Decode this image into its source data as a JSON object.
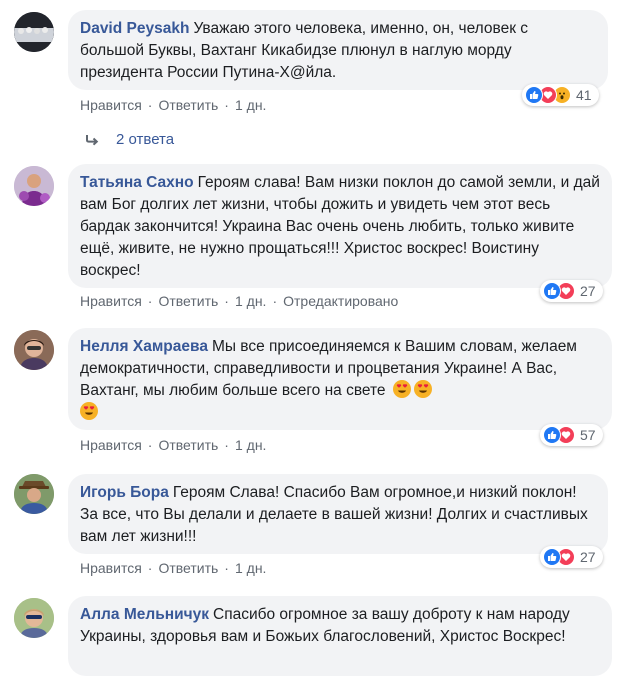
{
  "comments": [
    {
      "author": "David Peysakh",
      "text": "Уважаю этого человека, именно, он, человек с большой Буквы, Вахтанг Кикабидзе плюнул в наглую морду президента России Путина-Х@йла.",
      "like": "Нравится",
      "reply": "Ответить",
      "time": "1 дн.",
      "reactions": "41",
      "reaction_icons": [
        "like-icon",
        "love-icon",
        "wow-icon"
      ]
    },
    {
      "author": "Татьяна Сахно",
      "text": "Героям слава! Вам низки поклон до самой земли, и дай вам Бог долгих лет жизни, чтобы дожить и увидеть чем этот весь бардак закончится! Украина Вас очень очень любить, только живите ещё, живите, не нужно прощаться!!! Христос воскрес! Воистину воскрес!",
      "like": "Нравится",
      "reply": "Ответить",
      "time": "1 дн.",
      "edited": "Отредактировано",
      "reactions": "27",
      "reaction_icons": [
        "like-icon",
        "love-icon"
      ]
    },
    {
      "author": "Нелля Хамраева",
      "text": "Мы все присоединяемся к Вашим словам, желаем демократичности, справедливости и процветания Украине! А Вас, Вахтанг, мы любим больше всего на свете",
      "like": "Нравится",
      "reply": "Ответить",
      "time": "1 дн.",
      "reactions": "57",
      "reaction_icons": [
        "like-icon",
        "love-icon"
      ],
      "emojis": [
        "heart-eyes-emoji",
        "heart-eyes-emoji",
        "heart-eyes-emoji"
      ]
    },
    {
      "author": "Игорь Бора",
      "text": "Героям Слава! Спасибо Вам огромное,и низкий поклон! За все, что Вы делали и делаете в вашей жизни! Долгих и счастливых вам лет жизни!!!",
      "like": "Нравится",
      "reply": "Ответить",
      "time": "1 дн.",
      "reactions": "27",
      "reaction_icons": [
        "like-icon",
        "love-icon"
      ]
    },
    {
      "author": "Алла Мельничук",
      "text": "Спасибо огромное за вашу доброту к нам народу Украины, здоровья вам и Божьих благословений, Христос Воскрес!"
    }
  ],
  "replies_link": "2 ответа",
  "separator": "·",
  "colors": {
    "author": "#385898",
    "bubble": "#f2f3f5",
    "meta": "#606770",
    "like": "#2078f4",
    "love": "#f33e58",
    "wow": "#f7b125"
  }
}
